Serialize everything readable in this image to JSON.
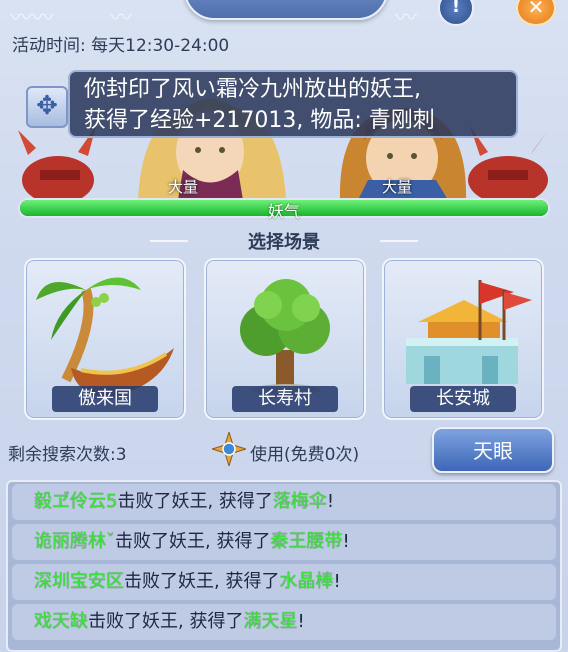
{
  "header": {
    "title": "",
    "info_label": "!",
    "close_label": "✕"
  },
  "activity_time": "活动时间: 每天12:30-24:00",
  "message": {
    "line1": "你封印了风い霜冷九州放出的妖王,",
    "line2": "获得了经验+217013, 物品: 青刚刺"
  },
  "characters": [
    {
      "amount_label": "大量"
    },
    {
      "amount_label": "大量"
    }
  ],
  "yaoqi": {
    "label": "妖气",
    "fill_fraction": 1.0
  },
  "section_title": "选择场景",
  "scenes": [
    {
      "label": "傲来国",
      "icon": "palm-tree-boat-icon"
    },
    {
      "label": "长寿村",
      "icon": "tree-icon"
    },
    {
      "label": "长安城",
      "icon": "castle-flag-icon"
    }
  ],
  "search": {
    "remaining": "剩余搜索次数:3",
    "use_free": "使用(免费0次)",
    "tianyan_button": "天眼"
  },
  "log": [
    {
      "player": "毅ヹ伶云5",
      "mid": "击败了妖王, 获得了",
      "item": "落梅伞",
      "end": "!"
    },
    {
      "player": "诡丽腾林ˇ",
      "mid": "击败了妖王, 获得了",
      "item": "秦王腰带",
      "end": "!"
    },
    {
      "player": "深圳宝安区",
      "mid": "击败了妖王, 获得了",
      "item": "水晶棒",
      "end": "!"
    },
    {
      "player": "戏天缺",
      "mid": "击败了妖王, 获得了",
      "item": "满天星",
      "end": "!"
    }
  ],
  "colors": {
    "accent_green": "#3fe23f",
    "button_blue": "#3d67b7",
    "panel_bg": "#cfd9ee"
  }
}
